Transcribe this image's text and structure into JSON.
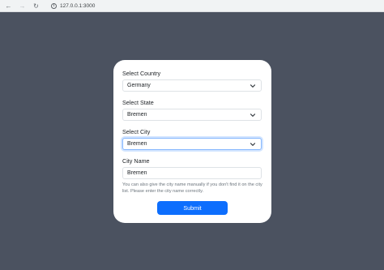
{
  "browser": {
    "url": "127.0.0.1:3000",
    "back_icon": "arrow-left-icon",
    "forward_icon": "arrow-right-icon",
    "reload_icon": "reload-icon"
  },
  "form": {
    "country": {
      "label": "Select Country",
      "value": "Germany"
    },
    "state": {
      "label": "Select State",
      "value": "Bremen"
    },
    "city": {
      "label": "Select City",
      "value": "Bremen"
    },
    "city_name": {
      "label": "City Name",
      "value": "Bremen"
    },
    "help_text": "You can also give the city name manually if you don't find it on the city list. Please enter the city name correctly.",
    "submit_label": "Submit"
  },
  "colors": {
    "page_background": "#4b5260",
    "card_background": "#ffffff",
    "primary": "#0d6efd",
    "focus_border": "#86b7fe"
  }
}
